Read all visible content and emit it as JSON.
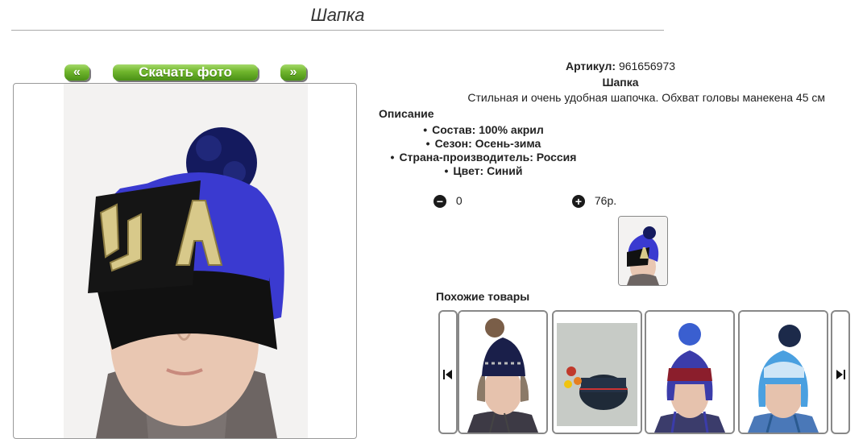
{
  "header": {
    "title": "Шапка"
  },
  "gallery": {
    "prev_label": "«",
    "download_label": "Скачать фото",
    "next_label": "»"
  },
  "product": {
    "article_label": "Артикул:",
    "article_value": "961656973",
    "name": "Шапка",
    "short_description": "Стильная и очень удобная шапочка. Обхват головы манекена 45 см",
    "description_heading": "Описание",
    "attributes": [
      "Состав: 100% акрил",
      "Сезон: Осень-зима",
      "Страна-производитель: Россия",
      "Цвет: Синий"
    ],
    "quantity": "0",
    "price": "76р."
  },
  "similar": {
    "heading": "Похожие товары"
  },
  "colors": {
    "accent_green": "#6fb52c",
    "hat_blue": "#3a3ad0",
    "hat_black": "#111111"
  },
  "icons": {
    "minus": "minus-circle-icon",
    "plus": "plus-circle-icon",
    "prev": "skip-back-icon",
    "next": "skip-forward-icon"
  }
}
